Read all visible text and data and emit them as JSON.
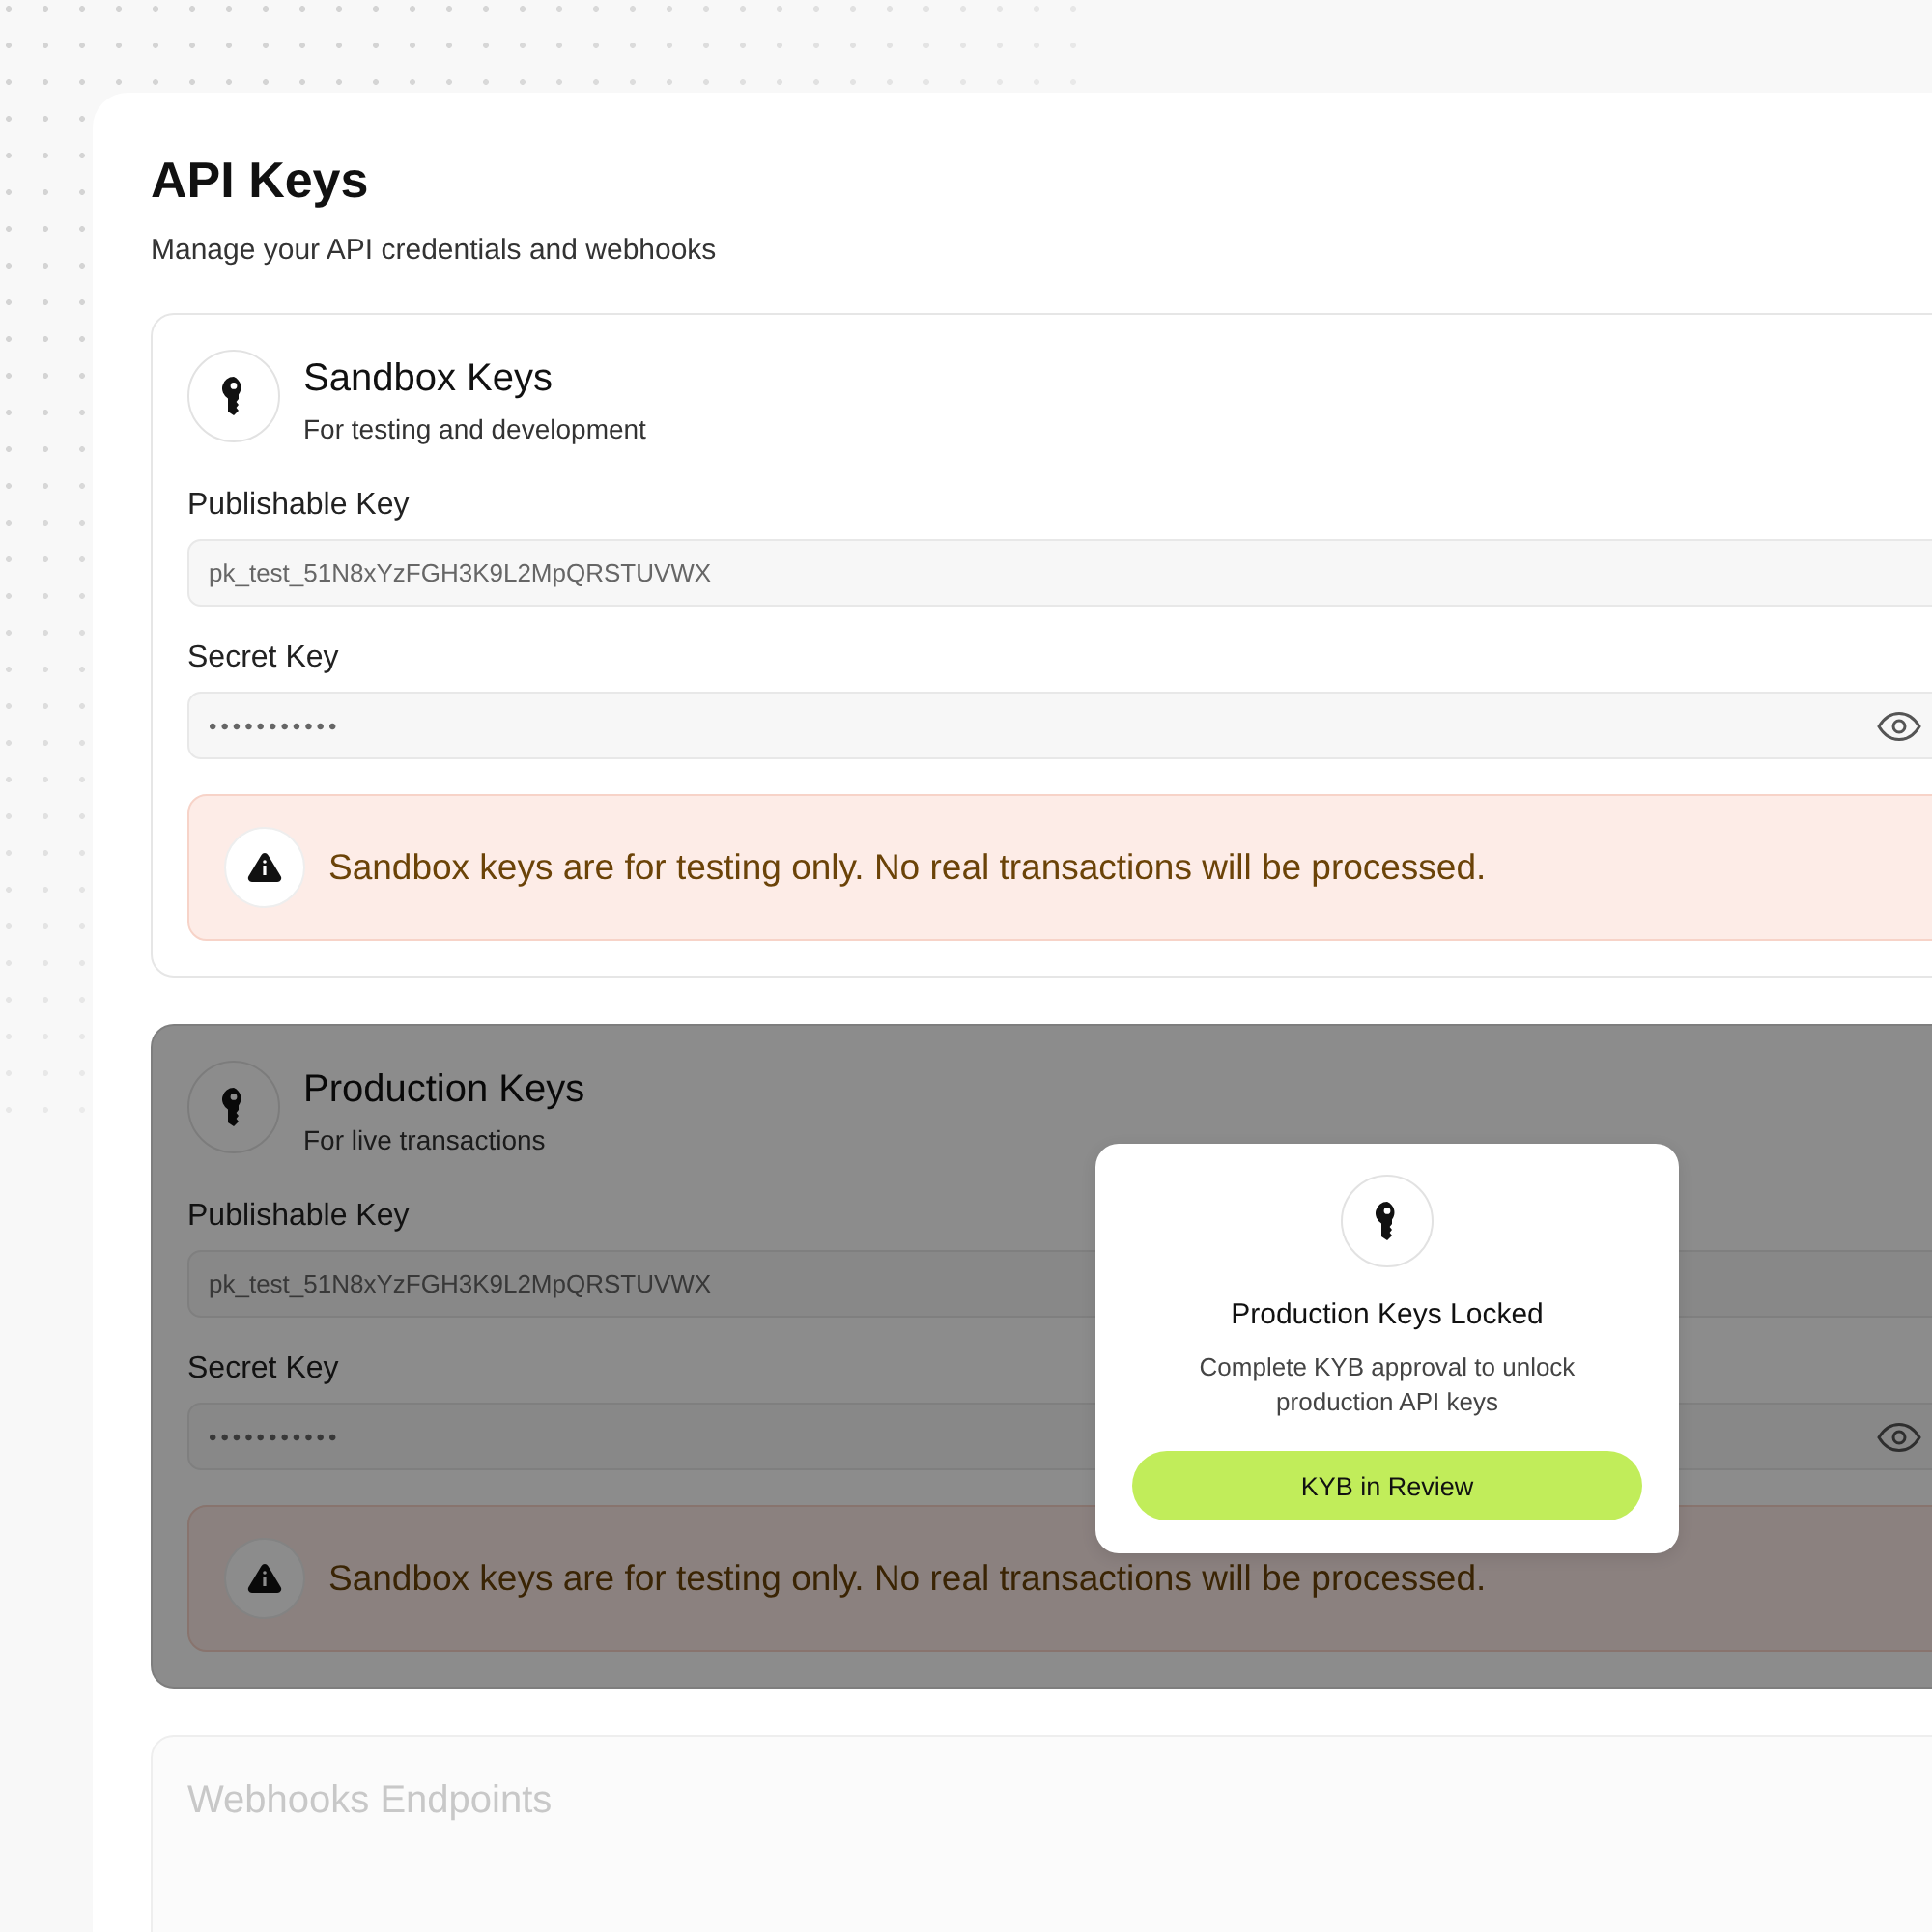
{
  "page": {
    "title": "API Keys",
    "subtitle": "Manage your API credentials and webhooks"
  },
  "sections": [
    {
      "title": "Sandbox Keys",
      "subtitle": "For testing and development",
      "locked": false,
      "fields": [
        {
          "label": "Publishable Key",
          "kind": "text",
          "value": "pk_test_51N8xYzFGH3K9L2MpQRSTUVWX"
        },
        {
          "label": "Secret Key",
          "kind": "secret",
          "value": "•••••••••••"
        }
      ],
      "notice": "Sandbox keys are for testing only. No real transactions will be processed."
    },
    {
      "title": "Production Keys",
      "subtitle": "For live transactions",
      "locked": true,
      "fields": [
        {
          "label": "Publishable Key",
          "kind": "text",
          "value": "pk_test_51N8xYzFGH3K9L2MpQRSTUVWX"
        },
        {
          "label": "Secret Key",
          "kind": "secret",
          "value": "•••••••••••"
        }
      ],
      "notice": "Sandbox keys are for testing only. No real transactions will be processed."
    }
  ],
  "lock_dialog": {
    "title": "Production Keys Locked",
    "message": "Complete KYB approval to unlock production API keys",
    "button": "KYB in Review"
  },
  "webhooks": {
    "title": "Webhooks Endpoints"
  }
}
